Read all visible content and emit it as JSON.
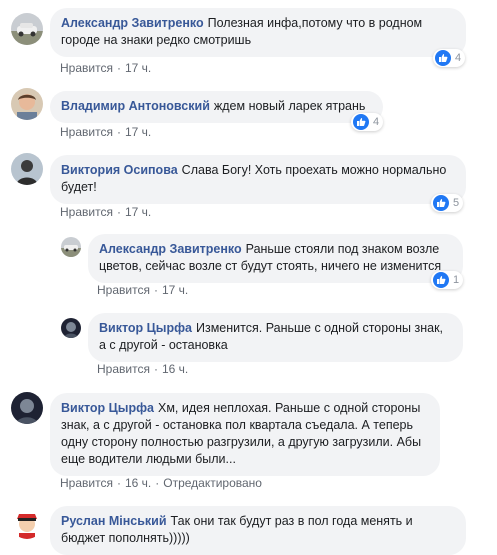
{
  "ui": {
    "like_label": "Нравится",
    "edited_label": "Отредактировано",
    "dot": "·"
  },
  "comments": [
    {
      "author": "Александр Завитренко",
      "text": "Полезная инфа,потому что в родном городе на знаки редко смотришь",
      "time": "17 ч.",
      "reactions": "4"
    },
    {
      "author": "Владимир Антоновский",
      "text": "ждем новый ларек ятрань",
      "time": "17 ч.",
      "reactions": "4"
    },
    {
      "author": "Виктория Осипова",
      "text": "Слава Богу! Хоть проехать можно нормально будет!",
      "time": "17 ч.",
      "reactions": "5"
    },
    {
      "author": "Александр Завитренко",
      "text": "Раньше стояли под знаком возле цветов, сейчас возле ст будут стоять, ничего не изменится",
      "time": "17 ч.",
      "reactions": "1"
    },
    {
      "author": "Виктор Цырфа",
      "text": "Изменится. Раньше с одной стороны знак, а с другой - остановка",
      "time": "16 ч."
    },
    {
      "author": "Виктор Цырфа",
      "text": "Хм, идея неплохая. Раньше с одной стороны знак, а с другой - остановка пол квартала съедала. А теперь одну сторону полностью разгрузили, а другую загрузили. Абы еще водители людьми были...",
      "time": "16 ч."
    },
    {
      "author": "Руслан Мінський",
      "text": "Так они так будут раз в пол года менять и бюджет пополнять)))))"
    }
  ],
  "colors": {
    "author": "#385898",
    "bubble": "#f2f3f5",
    "meta": "#616770",
    "like_badge": "#2078f4"
  }
}
